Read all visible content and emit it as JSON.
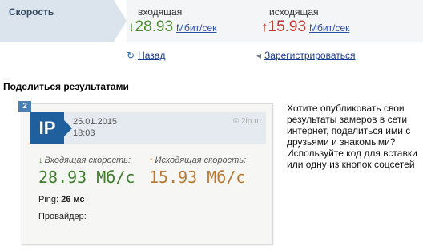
{
  "speed": {
    "label": "Скорость",
    "incoming": {
      "caption": "входящая",
      "arrow": "↓",
      "value": "28.93",
      "unit": "Мбит/сек"
    },
    "outgoing": {
      "caption": "исходящая",
      "arrow": "↑",
      "value": "15.93",
      "unit": "Мбит/сек"
    }
  },
  "links": {
    "back": "Назад",
    "register": "Зарегистрироваться"
  },
  "share": {
    "title": "Поделиться результатами",
    "card": {
      "number": "2",
      "logo": "IP",
      "date": "25.01.2015",
      "time": "18:03",
      "source": "© 2ip.ru",
      "download_caption": "Входящая скорость:",
      "upload_caption": "Исходящая скорость:",
      "download_value": "28.93 Мб/с",
      "upload_value": "15.93 Мб/с",
      "ping_label": "Ping:",
      "ping_value": "26 мс",
      "provider_label": "Провайдер:"
    },
    "description": "Хотите опубликовать свои результаты замеров в сети интернет, поделиться ими с друзьями и знакомыми? Используйте код для вставки или одну из кнопок соцсетей"
  },
  "colors": {
    "download": "#3f7f2e",
    "upload": "#b87a33",
    "accent": "#1f5f9e"
  }
}
